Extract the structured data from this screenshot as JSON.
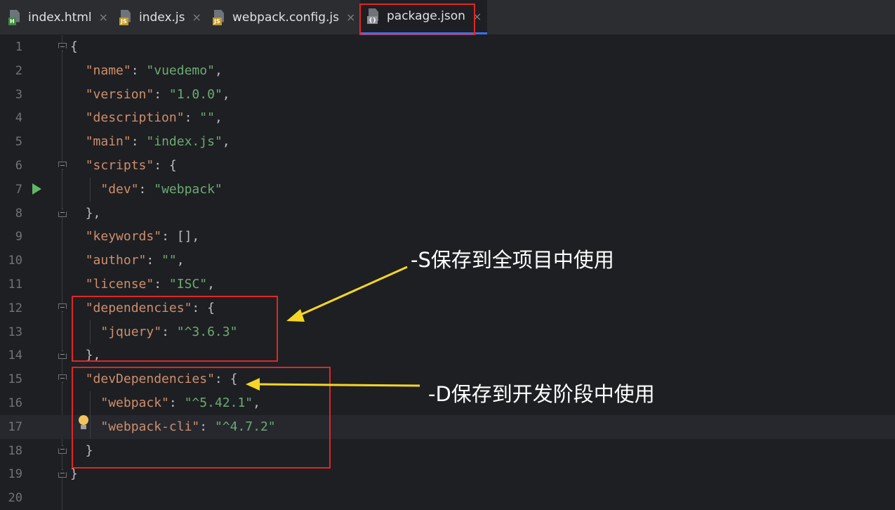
{
  "tabs": [
    {
      "label": "index.html",
      "badge": "H",
      "badge_color": "#3d8a3d",
      "active": false
    },
    {
      "label": "index.js",
      "badge": "JS",
      "badge_color": "#c29a2a",
      "active": false
    },
    {
      "label": "webpack.config.js",
      "badge": "JS",
      "badge_color": "#c29a2a",
      "active": false
    },
    {
      "label": "package.json",
      "badge": "{}",
      "badge_color": "#8c8f94",
      "active": true
    }
  ],
  "close_glyph": "×",
  "lines": [
    {
      "num": "1",
      "tokens": [
        {
          "t": "p",
          "v": "{"
        }
      ]
    },
    {
      "num": "2",
      "tokens": [
        {
          "t": "p",
          "v": "  "
        },
        {
          "t": "k",
          "v": "\"name\""
        },
        {
          "t": "p",
          "v": ": "
        },
        {
          "t": "s",
          "v": "\"vuedemo\""
        },
        {
          "t": "p",
          "v": ","
        }
      ]
    },
    {
      "num": "3",
      "tokens": [
        {
          "t": "p",
          "v": "  "
        },
        {
          "t": "k",
          "v": "\"version\""
        },
        {
          "t": "p",
          "v": ": "
        },
        {
          "t": "s",
          "v": "\"1.0.0\""
        },
        {
          "t": "p",
          "v": ","
        }
      ]
    },
    {
      "num": "4",
      "tokens": [
        {
          "t": "p",
          "v": "  "
        },
        {
          "t": "k",
          "v": "\"description\""
        },
        {
          "t": "p",
          "v": ": "
        },
        {
          "t": "s",
          "v": "\"\""
        },
        {
          "t": "p",
          "v": ","
        }
      ]
    },
    {
      "num": "5",
      "tokens": [
        {
          "t": "p",
          "v": "  "
        },
        {
          "t": "k",
          "v": "\"main\""
        },
        {
          "t": "p",
          "v": ": "
        },
        {
          "t": "s",
          "v": "\"index.js\""
        },
        {
          "t": "p",
          "v": ","
        }
      ]
    },
    {
      "num": "6",
      "tokens": [
        {
          "t": "p",
          "v": "  "
        },
        {
          "t": "k",
          "v": "\"scripts\""
        },
        {
          "t": "p",
          "v": ": {"
        }
      ]
    },
    {
      "num": "7",
      "tokens": [
        {
          "t": "p",
          "v": "    "
        },
        {
          "t": "k",
          "v": "\"dev\""
        },
        {
          "t": "p",
          "v": ": "
        },
        {
          "t": "s",
          "v": "\"webpack\""
        }
      ]
    },
    {
      "num": "8",
      "tokens": [
        {
          "t": "p",
          "v": "  },"
        }
      ]
    },
    {
      "num": "9",
      "tokens": [
        {
          "t": "p",
          "v": "  "
        },
        {
          "t": "k",
          "v": "\"keywords\""
        },
        {
          "t": "p",
          "v": ": [],"
        }
      ]
    },
    {
      "num": "10",
      "tokens": [
        {
          "t": "p",
          "v": "  "
        },
        {
          "t": "k",
          "v": "\"author\""
        },
        {
          "t": "p",
          "v": ": "
        },
        {
          "t": "s",
          "v": "\"\""
        },
        {
          "t": "p",
          "v": ","
        }
      ]
    },
    {
      "num": "11",
      "tokens": [
        {
          "t": "p",
          "v": "  "
        },
        {
          "t": "k",
          "v": "\"license\""
        },
        {
          "t": "p",
          "v": ": "
        },
        {
          "t": "s",
          "v": "\"ISC\""
        },
        {
          "t": "p",
          "v": ","
        }
      ]
    },
    {
      "num": "12",
      "tokens": [
        {
          "t": "p",
          "v": "  "
        },
        {
          "t": "k",
          "v": "\"dependencies\""
        },
        {
          "t": "p",
          "v": ": {"
        }
      ]
    },
    {
      "num": "13",
      "tokens": [
        {
          "t": "p",
          "v": "    "
        },
        {
          "t": "k",
          "v": "\"jquery\""
        },
        {
          "t": "p",
          "v": ": "
        },
        {
          "t": "s",
          "v": "\"^3.6.3\""
        }
      ]
    },
    {
      "num": "14",
      "tokens": [
        {
          "t": "p",
          "v": "  },"
        }
      ]
    },
    {
      "num": "15",
      "tokens": [
        {
          "t": "p",
          "v": "  "
        },
        {
          "t": "k",
          "v": "\"devDependencies\""
        },
        {
          "t": "p",
          "v": ": {"
        }
      ]
    },
    {
      "num": "16",
      "tokens": [
        {
          "t": "p",
          "v": "    "
        },
        {
          "t": "k",
          "v": "\"webpack\""
        },
        {
          "t": "p",
          "v": ": "
        },
        {
          "t": "s",
          "v": "\"^5.42.1\""
        },
        {
          "t": "p",
          "v": ","
        }
      ]
    },
    {
      "num": "17",
      "tokens": [
        {
          "t": "p",
          "v": "    "
        },
        {
          "t": "k",
          "v": "\"webpack-cli\""
        },
        {
          "t": "p",
          "v": ": "
        },
        {
          "t": "s",
          "v": "\"^4.7.2\""
        }
      ]
    },
    {
      "num": "18",
      "tokens": [
        {
          "t": "p",
          "v": "  }"
        }
      ]
    },
    {
      "num": "19",
      "tokens": [
        {
          "t": "p",
          "v": "}"
        }
      ]
    },
    {
      "num": "20",
      "tokens": []
    }
  ],
  "current_line": "17",
  "annotations": {
    "save_s": "-S保存到全项目中使用",
    "save_d": "-D保存到开发阶段中使用"
  },
  "colors": {
    "key": "#cf8e6d",
    "string": "#6aab73",
    "punct": "#bcbec4",
    "highlight_box": "#e12626",
    "arrow": "#f5d626"
  }
}
